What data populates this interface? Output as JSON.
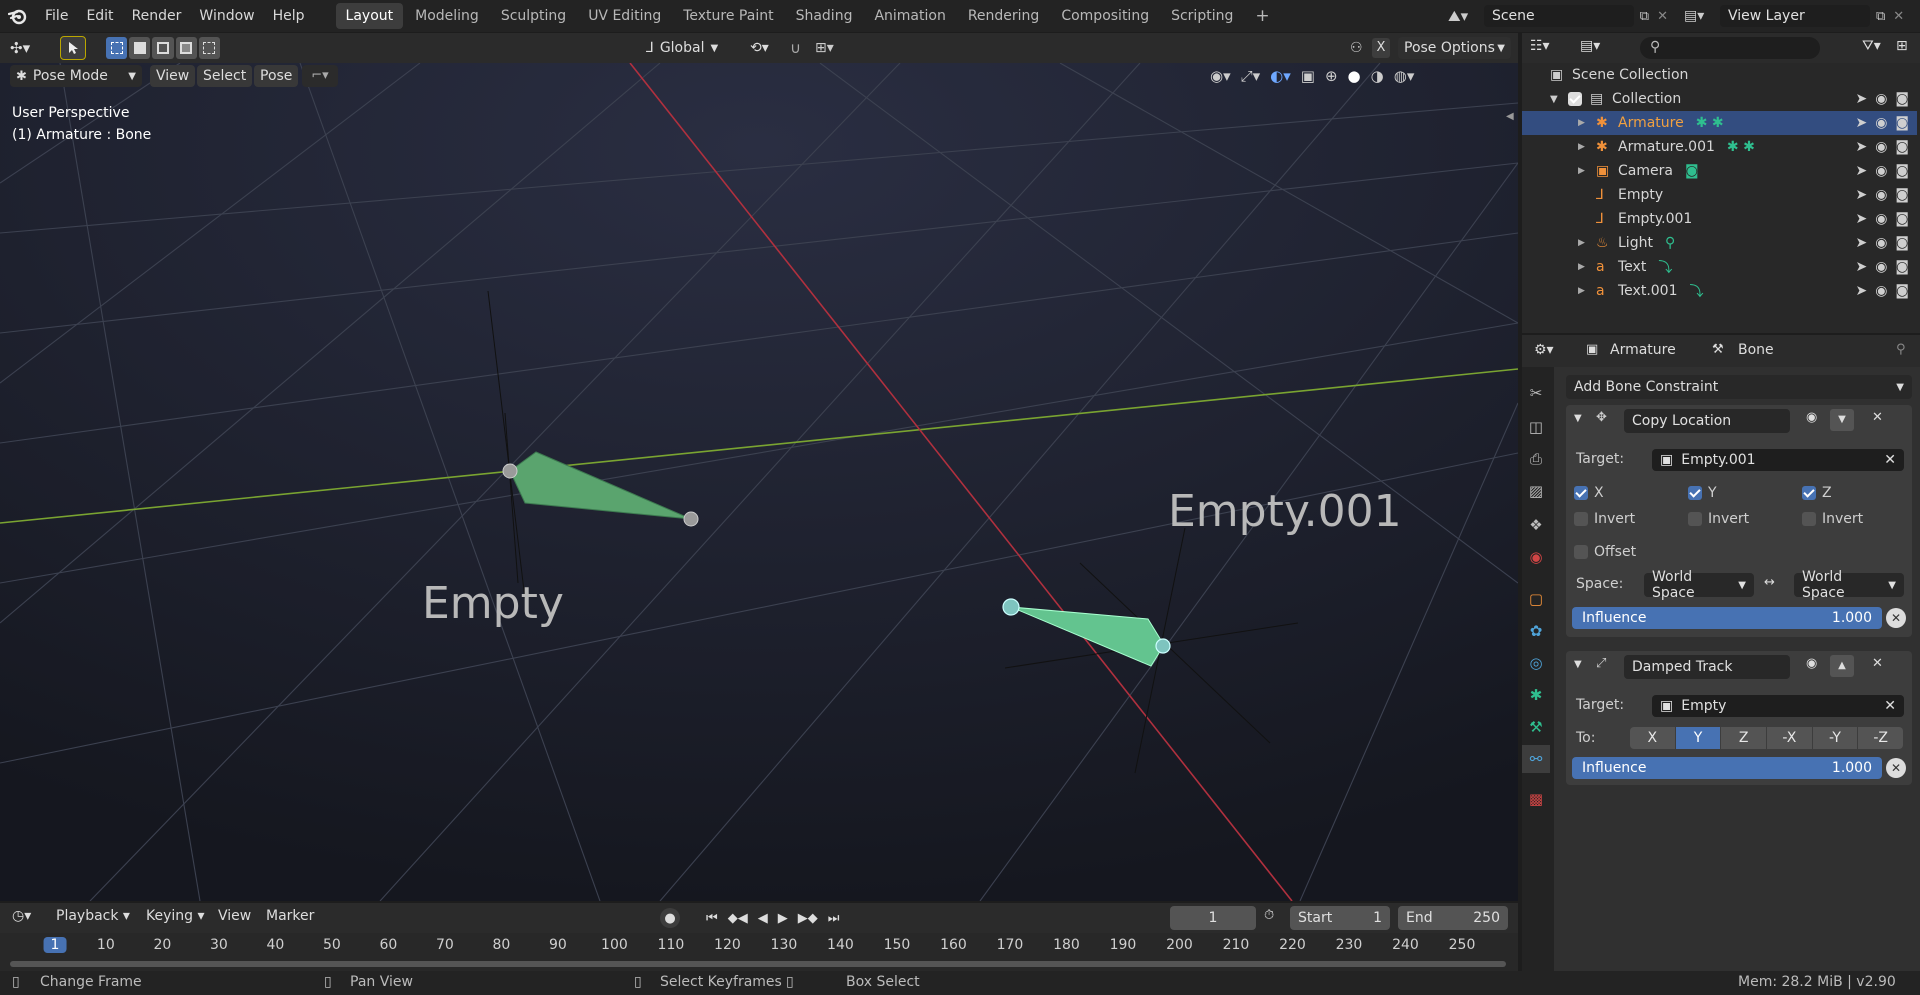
{
  "menubar": {
    "menus": [
      "File",
      "Edit",
      "Render",
      "Window",
      "Help"
    ],
    "workspaces": [
      "Layout",
      "Modeling",
      "Sculpting",
      "UV Editing",
      "Texture Paint",
      "Shading",
      "Animation",
      "Rendering",
      "Compositing",
      "Scripting"
    ],
    "active_workspace": "Layout",
    "add_tab": "+",
    "scene_name": "Scene",
    "view_layer_name": "View Layer"
  },
  "viewport_header": {
    "transform_orientation": "Global",
    "pose_options": "Pose Options",
    "mode": "Pose Mode",
    "menus": [
      "View",
      "Select",
      "Pose"
    ],
    "x_toggle": "X"
  },
  "viewport": {
    "perspective_label": "User Perspective",
    "active_object_label": "(1) Armature : Bone",
    "empty_label": "Empty",
    "empty001_label": "Empty.001",
    "colors": {
      "x_axis": "#b0303e",
      "y_axis": "#7aa431",
      "bone": "#5aa46e",
      "bone_selected": "#63c48f",
      "background": "#1c1f2e"
    }
  },
  "outliner": {
    "root": "Scene Collection",
    "collection": "Collection",
    "items": [
      {
        "label": "Armature",
        "selected": true
      },
      {
        "label": "Armature.001",
        "selected": false
      },
      {
        "label": "Camera",
        "selected": false
      },
      {
        "label": "Empty",
        "selected": false
      },
      {
        "label": "Empty.001",
        "selected": false
      },
      {
        "label": "Light",
        "selected": false
      },
      {
        "label": "Text",
        "selected": false
      },
      {
        "label": "Text.001",
        "selected": false
      }
    ]
  },
  "properties": {
    "breadcrumb_object": "Armature",
    "breadcrumb_bone": "Bone",
    "add_constraint": "Add Bone Constraint",
    "copy_location": {
      "name": "Copy Location",
      "target_label": "Target:",
      "target": "Empty.001",
      "axes": [
        {
          "label": "X",
          "checked": true
        },
        {
          "label": "Y",
          "checked": true
        },
        {
          "label": "Z",
          "checked": true
        }
      ],
      "invert_label": "Invert",
      "offset_label": "Offset",
      "space_label": "Space:",
      "owner_space": "World Space",
      "target_space": "World Space",
      "influence_label": "Influence",
      "influence_value": "1.000"
    },
    "damped_track": {
      "name": "Damped Track",
      "target_label": "Target:",
      "target": "Empty",
      "to_label": "To:",
      "track_axes": [
        "X",
        "Y",
        "Z",
        "-X",
        "-Y",
        "-Z"
      ],
      "active_track_axis": "Y",
      "influence_label": "Influence",
      "influence_value": "1.000"
    }
  },
  "timeline": {
    "menus": [
      "Playback",
      "Keying",
      "View",
      "Marker"
    ],
    "current_frame": "1",
    "start_label": "Start",
    "start_value": "1",
    "end_label": "End",
    "end_value": "250",
    "ticks": [
      "1",
      "10",
      "20",
      "30",
      "40",
      "50",
      "60",
      "70",
      "80",
      "90",
      "100",
      "110",
      "120",
      "130",
      "140",
      "150",
      "160",
      "170",
      "180",
      "190",
      "200",
      "210",
      "220",
      "230",
      "240",
      "250"
    ]
  },
  "statusbar": {
    "hints": [
      "Change Frame",
      "Pan View",
      "Select Keyframes",
      "Box Select"
    ],
    "memory": "Mem: 28.2 MiB | v2.90"
  }
}
